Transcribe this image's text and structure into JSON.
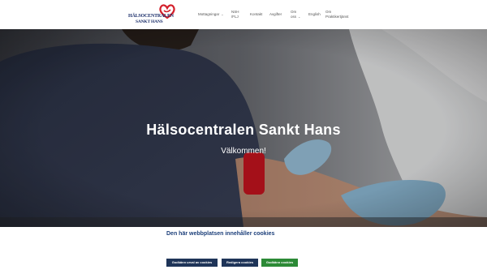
{
  "logo": {
    "line1": "HÄLSOCENTRALEN",
    "line2": "SANKT HANS",
    "heart_color": "#d4202b"
  },
  "nav": {
    "items": [
      {
        "label": "Mottagningar",
        "has_dropdown": true
      },
      {
        "label": "NSH",
        "label2": "/FLJ"
      },
      {
        "label": "Kontakt"
      },
      {
        "label": "Avgifter"
      },
      {
        "label": "Om",
        "label2": "oss",
        "has_dropdown": true
      },
      {
        "label": "English"
      },
      {
        "label": "Om",
        "label2": "Praktikertjänst"
      }
    ]
  },
  "hero": {
    "title": "Hälsocentralen Sankt Hans",
    "subtitle": "Välkommen!"
  },
  "cookie": {
    "title": "Den här webbplatsen innehåller cookies",
    "text": "",
    "buttons": {
      "selected": "Godkänn urval av cookies",
      "edit": "Redigera cookies",
      "accept": "Godkänn cookies"
    },
    "colors": {
      "title": "#1c3f7a",
      "dark_button": "#1e3458",
      "accept_button": "#2c8a36"
    }
  }
}
